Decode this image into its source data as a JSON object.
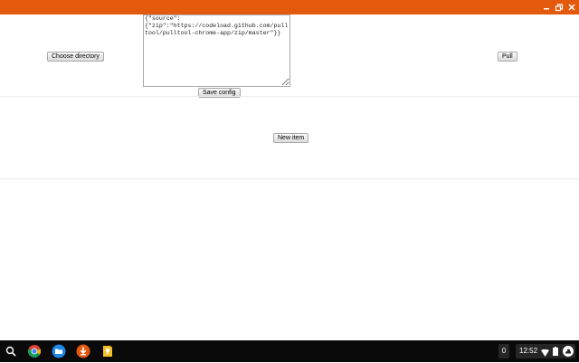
{
  "window": {
    "accent_color": "#e45a0d",
    "controls": [
      "minimize-icon",
      "maximize-icon",
      "close-icon"
    ]
  },
  "toolbar": {
    "choose_directory_label": "Choose directory",
    "pull_label": "Pull",
    "save_config_label": "Save config"
  },
  "config": {
    "value": "{\"source\":\n{\"zip\":\"https://codeload.github.com/pulltool/pulltool-chrome-app/zip/master\"}}"
  },
  "items": {
    "new_item_label": "New item"
  },
  "shelf": {
    "apps": [
      "launcher-search-icon",
      "chrome-icon",
      "files-icon",
      "download-icon",
      "keep-icon"
    ],
    "notification_count": "0",
    "clock": "12:52",
    "status_icons": [
      "wifi-icon",
      "battery-icon",
      "account-icon"
    ]
  }
}
